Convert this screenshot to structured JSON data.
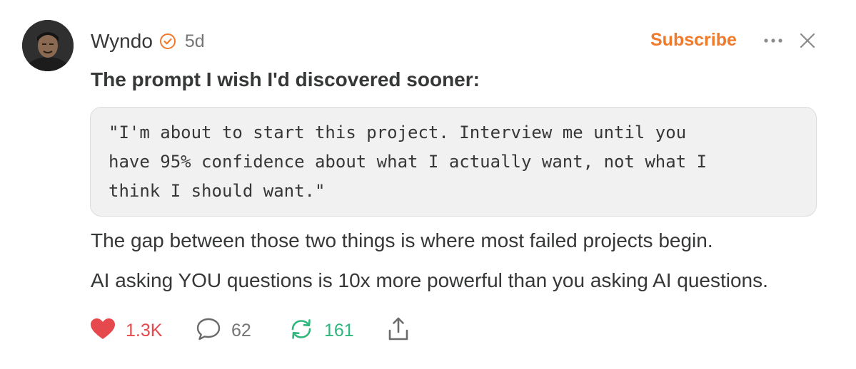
{
  "post": {
    "author": "Wyndo",
    "time": "5d",
    "subscribe_label": "Subscribe",
    "headline": "The prompt I wish I'd discovered sooner:",
    "quote_lines": [
      "\"I'm about to start this project. Interview me until you",
      "have 95% confidence about what I actually want, not what I",
      "think I should want.\""
    ],
    "paragraphs": [
      "The gap between those two things is where most failed projects begin.",
      "AI asking YOU questions is 10x more powerful than you asking AI questions."
    ]
  },
  "actions": {
    "likes": "1.3K",
    "comments": "62",
    "restacks": "161"
  },
  "icons": {
    "verified": "verified-badge-icon",
    "more": "more-dots-icon",
    "close": "close-icon",
    "like": "heart-icon",
    "comment": "comment-bubble-icon",
    "restack": "restack-arrows-icon",
    "share": "share-icon"
  },
  "colors": {
    "accent": "#f07a2c",
    "like": "#e5484d",
    "restack": "#2eb67d",
    "text": "#363737",
    "muted": "#757575",
    "quote_bg": "#f1f1f1"
  }
}
